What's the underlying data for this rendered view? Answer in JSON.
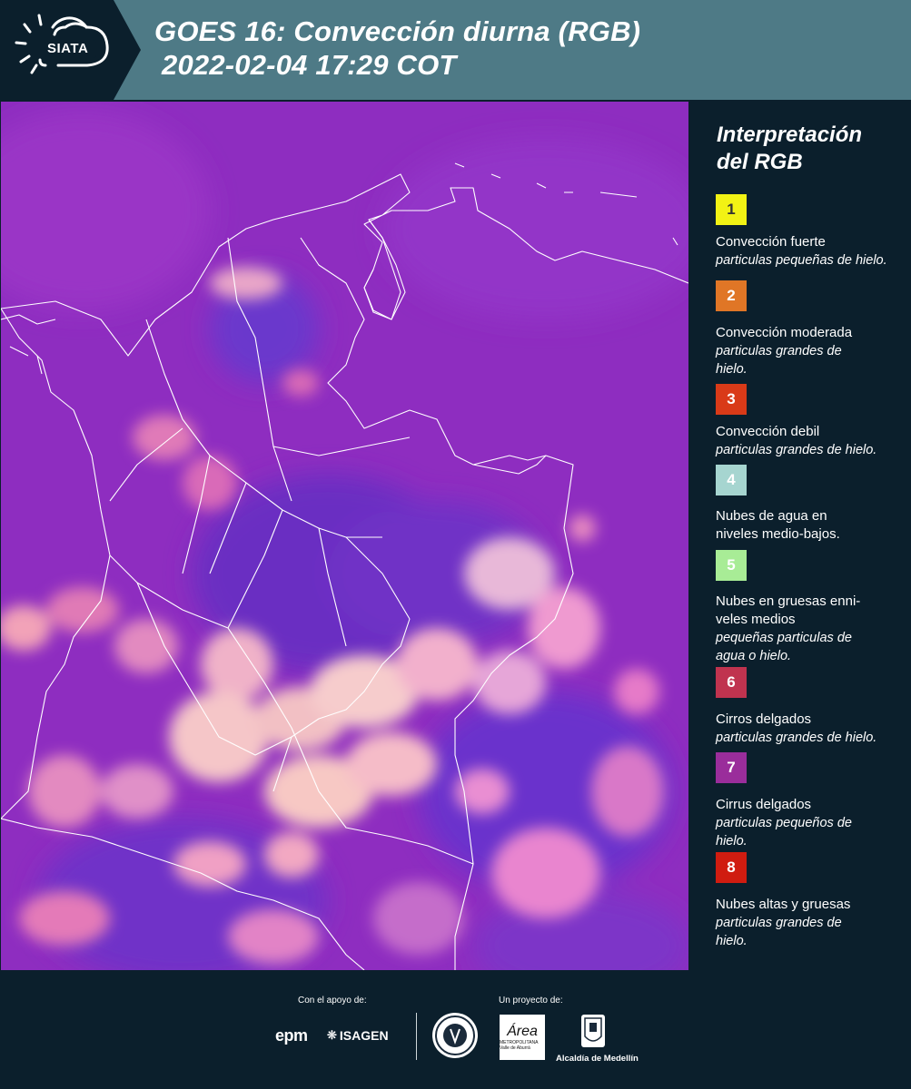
{
  "header": {
    "logo_text": "SIATA",
    "title_line1": "GOES 16: Convección diurna (RGB)",
    "title_line2": "2022-02-04 17:29 COT"
  },
  "legend": {
    "title_line1": "Interpretación",
    "title_line2": "del RGB",
    "items": [
      {
        "num": "1",
        "color": "#f2f214",
        "text_color": "#333333",
        "title": "Convección fuerte",
        "desc": "particulas pequeñas de hielo."
      },
      {
        "num": "2",
        "color": "#e07626",
        "text_color": "#ffffff",
        "title": "Convección moderada",
        "desc": "particulas grandes de hielo."
      },
      {
        "num": "3",
        "color": "#d93a18",
        "text_color": "#ffffff",
        "title": "Convección debil",
        "desc": "particulas grandes de hielo."
      },
      {
        "num": "4",
        "color": "#a6d5d0",
        "text_color": "#ffffff",
        "title": "Nubes de agua en niveles medio-bajos.",
        "desc": ""
      },
      {
        "num": "5",
        "color": "#a8ec96",
        "text_color": "#ffffff",
        "title": "Nubes en gruesas enni-veles medios",
        "desc": "pequeñas particulas de agua o hielo."
      },
      {
        "num": "6",
        "color": "#c0334f",
        "text_color": "#ffffff",
        "title": "Cirros delgados",
        "desc": "particulas grandes de hielo."
      },
      {
        "num": "7",
        "color": "#9a2d9b",
        "text_color": "#ffffff",
        "title": "Cirrus delgados",
        "desc": "particulas pequeños de hielo."
      },
      {
        "num": "8",
        "color": "#d01c10",
        "text_color": "#ffffff",
        "title": "Nubes altas y gruesas",
        "desc": "particulas grandes de hielo."
      }
    ]
  },
  "footer": {
    "support_label": "Con el apoyo de:",
    "project_label": "Un proyecto de:",
    "sponsor1": "epm",
    "sponsor2": "ISAGEN",
    "partner_area": "Área",
    "partner_area_sub": "METROPOLITANA Valle de Aburrá",
    "partner_alcaldia": "Alcaldía de Medellín"
  },
  "map": {
    "image": "satellite RGB composite over Colombia and surrounding region",
    "base_color": "#8b2cb8"
  }
}
